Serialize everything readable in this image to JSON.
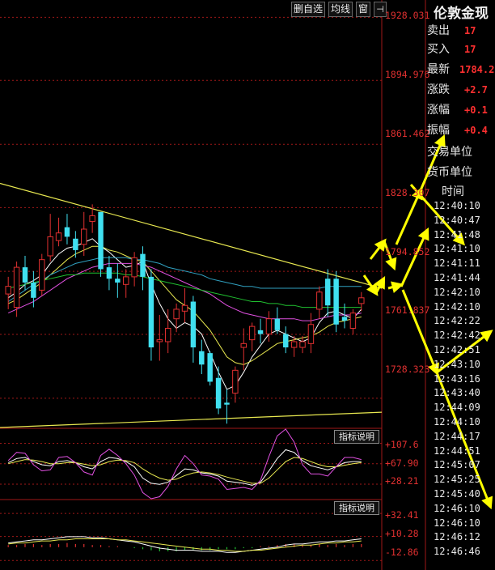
{
  "toolbar": {
    "delete_label": "删自选",
    "ma_label": "均线",
    "window_label": "窗",
    "pin_icon": "pin-icon"
  },
  "price_axis": [
    "1928.031",
    "1894.976",
    "1861.462",
    "1828.307",
    "1794.852",
    "1761.837",
    "1728.323"
  ],
  "indicator1": {
    "button": "指标说明",
    "labels": [
      "+107.6",
      "+67.90",
      "+28.21"
    ]
  },
  "indicator2": {
    "button": "指标说明",
    "labels": [
      "+32.41",
      "+10.28",
      "-12.86"
    ]
  },
  "quote_panel": {
    "title": "伦敦金现",
    "rows": [
      {
        "label": "卖出",
        "value": "17"
      },
      {
        "label": "买入",
        "value": "17"
      },
      {
        "label": "最新",
        "value": "1784.2"
      },
      {
        "label": "涨跌",
        "value": "+2.7"
      },
      {
        "label": "涨幅",
        "value": "+0.1"
      },
      {
        "label": "振幅",
        "value": "+0.4"
      }
    ],
    "trade_unit": "交易单位",
    "currency_unit": "货币单位",
    "time_header": "时间",
    "times": [
      "12:40:10",
      "12:40:47",
      "12:41:48",
      "12:41:10",
      "12:41:11",
      "12:41:44",
      "12:42:10",
      "12:42:10",
      "12:42:22",
      "12:42:42",
      "12:42:51",
      "12:43:10",
      "12:43:16",
      "12:43:40",
      "12:44:09",
      "12:44:10",
      "12:44:17",
      "12:44:51",
      "12:45:07",
      "12:45:25",
      "12:45:40",
      "12:46:10",
      "12:46:10",
      "12:46:12",
      "12:46:46"
    ]
  },
  "colors": {
    "up": "#e03030",
    "down": "#40e0f0",
    "arrow": "#ffff00",
    "trendline": "#e8e850",
    "bg": "#000000"
  },
  "chart_data": {
    "type": "candlestick",
    "y_axis_ticks": [
      1928.031,
      1894.976,
      1861.462,
      1828.307,
      1794.852,
      1761.837,
      1728.323
    ],
    "ylim": [
      1713,
      1935
    ],
    "candles": [
      {
        "o": 1783,
        "h": 1792,
        "l": 1775,
        "c": 1787
      },
      {
        "o": 1776,
        "h": 1800,
        "l": 1771,
        "c": 1797
      },
      {
        "o": 1797,
        "h": 1803,
        "l": 1785,
        "c": 1789
      },
      {
        "o": 1789,
        "h": 1795,
        "l": 1776,
        "c": 1781
      },
      {
        "o": 1785,
        "h": 1804,
        "l": 1782,
        "c": 1801
      },
      {
        "o": 1803,
        "h": 1825,
        "l": 1800,
        "c": 1813
      },
      {
        "o": 1811,
        "h": 1823,
        "l": 1808,
        "c": 1815
      },
      {
        "o": 1818,
        "h": 1825,
        "l": 1809,
        "c": 1813
      },
      {
        "o": 1812,
        "h": 1816,
        "l": 1802,
        "c": 1806
      },
      {
        "o": 1809,
        "h": 1826,
        "l": 1803,
        "c": 1817
      },
      {
        "o": 1821,
        "h": 1830,
        "l": 1815,
        "c": 1824
      },
      {
        "o": 1826,
        "h": 1824,
        "l": 1792,
        "c": 1796
      },
      {
        "o": 1797,
        "h": 1803,
        "l": 1785,
        "c": 1791
      },
      {
        "o": 1791,
        "h": 1799,
        "l": 1781,
        "c": 1789
      },
      {
        "o": 1788,
        "h": 1796,
        "l": 1781,
        "c": 1792
      },
      {
        "o": 1792,
        "h": 1805,
        "l": 1787,
        "c": 1802
      },
      {
        "o": 1804,
        "h": 1808,
        "l": 1785,
        "c": 1792
      },
      {
        "o": 1792,
        "h": 1796,
        "l": 1748,
        "c": 1755
      },
      {
        "o": 1758,
        "h": 1772,
        "l": 1748,
        "c": 1759
      },
      {
        "o": 1758,
        "h": 1775,
        "l": 1752,
        "c": 1765
      },
      {
        "o": 1770,
        "h": 1778,
        "l": 1763,
        "c": 1775
      },
      {
        "o": 1774,
        "h": 1786,
        "l": 1768,
        "c": 1777
      },
      {
        "o": 1779,
        "h": 1782,
        "l": 1747,
        "c": 1755
      },
      {
        "o": 1753,
        "h": 1759,
        "l": 1741,
        "c": 1746
      },
      {
        "o": 1752,
        "h": 1753,
        "l": 1735,
        "c": 1737
      },
      {
        "o": 1739,
        "h": 1745,
        "l": 1720,
        "c": 1723
      },
      {
        "o": 1726,
        "h": 1733,
        "l": 1715,
        "c": 1725
      },
      {
        "o": 1731,
        "h": 1745,
        "l": 1726,
        "c": 1743
      },
      {
        "o": 1755,
        "h": 1765,
        "l": 1743,
        "c": 1757
      },
      {
        "o": 1759,
        "h": 1768,
        "l": 1753,
        "c": 1766
      },
      {
        "o": 1764,
        "h": 1770,
        "l": 1757,
        "c": 1762
      },
      {
        "o": 1762,
        "h": 1774,
        "l": 1758,
        "c": 1770
      },
      {
        "o": 1770,
        "h": 1776,
        "l": 1762,
        "c": 1764
      },
      {
        "o": 1762,
        "h": 1766,
        "l": 1752,
        "c": 1755
      },
      {
        "o": 1755,
        "h": 1761,
        "l": 1750,
        "c": 1758
      },
      {
        "o": 1755,
        "h": 1761,
        "l": 1752,
        "c": 1758
      },
      {
        "o": 1757,
        "h": 1773,
        "l": 1752,
        "c": 1767
      },
      {
        "o": 1775,
        "h": 1787,
        "l": 1770,
        "c": 1784
      },
      {
        "o": 1791,
        "h": 1796,
        "l": 1771,
        "c": 1777
      },
      {
        "o": 1791,
        "h": 1795,
        "l": 1763,
        "c": 1767
      },
      {
        "o": 1771,
        "h": 1778,
        "l": 1765,
        "c": 1769
      },
      {
        "o": 1765,
        "h": 1775,
        "l": 1762,
        "c": 1773
      },
      {
        "o": 1778,
        "h": 1784,
        "l": 1774,
        "c": 1781
      }
    ],
    "moving_averages": [
      {
        "name": "MA1",
        "color": "#ffffff",
        "values": [
          1781,
          1784,
          1788,
          1790,
          1793,
          1799,
          1804,
          1807,
          1808,
          1810,
          1812,
          1808,
          1805,
          1801,
          1797,
          1798,
          1800,
          1788,
          1778,
          1770,
          1765,
          1768,
          1766,
          1762,
          1752,
          1742,
          1733,
          1735,
          1742,
          1750,
          1756,
          1762,
          1764,
          1762,
          1760,
          1758,
          1760,
          1768,
          1773,
          1774,
          1772,
          1770,
          1775
        ]
      },
      {
        "name": "MA2",
        "color": "#e8e850",
        "values": [
          1778,
          1780,
          1783,
          1786,
          1789,
          1793,
          1797,
          1801,
          1804,
          1806,
          1808,
          1808,
          1806,
          1805,
          1803,
          1801,
          1800,
          1795,
          1790,
          1785,
          1780,
          1777,
          1774,
          1769,
          1764,
          1757,
          1750,
          1747,
          1746,
          1748,
          1751,
          1754,
          1757,
          1758,
          1759,
          1760,
          1761,
          1763,
          1766,
          1768,
          1769,
          1770,
          1771
        ]
      },
      {
        "name": "MA3",
        "color": "#e050e0",
        "values": [
          1773,
          1775,
          1777,
          1779,
          1782,
          1785,
          1788,
          1791,
          1793,
          1795,
          1797,
          1798,
          1799,
          1799,
          1799,
          1799,
          1798,
          1797,
          1795,
          1793,
          1791,
          1789,
          1787,
          1785,
          1783,
          1780,
          1777,
          1775,
          1773,
          1772,
          1771,
          1770,
          1770,
          1770,
          1770,
          1769,
          1769,
          1770,
          1771,
          1772,
          1772,
          1772,
          1773
        ]
      },
      {
        "name": "MA4",
        "color": "#20c030",
        "values": [
          1786,
          1787,
          1788,
          1789,
          1790,
          1791,
          1792,
          1793,
          1793,
          1794,
          1794,
          1794,
          1794,
          1794,
          1793,
          1793,
          1792,
          1791,
          1790,
          1789,
          1788,
          1787,
          1786,
          1785,
          1784,
          1783,
          1782,
          1781,
          1780,
          1779,
          1779,
          1778,
          1778,
          1777,
          1777,
          1776,
          1776,
          1776,
          1776,
          1776,
          1776,
          1776,
          1776
        ]
      },
      {
        "name": "MA5",
        "color": "#30a0c0",
        "values": [
          1779,
          1782,
          1785,
          1788,
          1790,
          1793,
          1795,
          1797,
          1799,
          1800,
          1801,
          1802,
          1802,
          1802,
          1802,
          1801,
          1801,
          1800,
          1799,
          1797,
          1796,
          1795,
          1794,
          1793,
          1791,
          1790,
          1789,
          1788,
          1787,
          1787,
          1786,
          1786,
          1786,
          1786,
          1786,
          1786,
          1786,
          1786,
          1787,
          1787,
          1787,
          1787,
          1787
        ]
      }
    ],
    "trendlines": [
      {
        "from": [
          0,
          1841
        ],
        "to": [
          43,
          1786
        ]
      },
      {
        "from": [
          0,
          1713
        ],
        "to": [
          43,
          1721
        ]
      }
    ],
    "indicator1": {
      "ticks": [
        107.6,
        67.9,
        28.21
      ],
      "ylim": [
        0,
        135
      ],
      "series": [
        {
          "name": "K",
          "color": "#ffffff",
          "values": [
            70,
            78,
            80,
            72,
            66,
            64,
            72,
            74,
            70,
            62,
            58,
            72,
            80,
            78,
            72,
            62,
            40,
            30,
            28,
            32,
            45,
            58,
            56,
            50,
            48,
            44,
            34,
            32,
            30,
            26,
            32,
            54,
            78,
            95,
            90,
            74,
            64,
            60,
            56,
            62,
            70,
            72,
            72
          ]
        },
        {
          "name": "D",
          "color": "#e8e850",
          "values": [
            68,
            72,
            76,
            75,
            72,
            68,
            68,
            70,
            70,
            67,
            64,
            66,
            72,
            75,
            74,
            70,
            58,
            48,
            40,
            36,
            38,
            45,
            50,
            52,
            50,
            47,
            42,
            38,
            34,
            30,
            30,
            40,
            56,
            72,
            80,
            78,
            72,
            66,
            62,
            62,
            65,
            68,
            70
          ]
        },
        {
          "name": "J",
          "color": "#e050e0",
          "values": [
            74,
            90,
            88,
            66,
            54,
            56,
            80,
            82,
            70,
            52,
            46,
            84,
            96,
            84,
            68,
            46,
            12,
            -6,
            4,
            24,
            58,
            84,
            68,
            46,
            44,
            38,
            18,
            20,
            22,
            18,
            36,
            82,
            122,
            141,
            110,
            66,
            48,
            48,
            44,
            62,
            80,
            80,
            76
          ]
        }
      ]
    },
    "indicator2": {
      "ticks": [
        32.41,
        10.28,
        -12.86
      ],
      "ylim": [
        -22,
        45
      ],
      "series": [
        {
          "name": "DIF",
          "color": "#ffffff",
          "values": [
            4,
            5,
            6,
            7,
            7,
            8,
            9,
            10,
            10,
            10,
            9,
            9,
            8,
            7,
            6,
            5,
            3,
            1,
            -1,
            -2,
            -3,
            -3,
            -3,
            -4,
            -4,
            -4,
            -5,
            -5,
            -4,
            -3,
            -2,
            -1,
            0,
            2,
            3,
            3,
            4,
            5,
            5,
            6,
            6,
            7,
            8
          ]
        },
        {
          "name": "DEA",
          "color": "#e8e850",
          "values": [
            3,
            4,
            4,
            5,
            6,
            6,
            7,
            7,
            8,
            8,
            8,
            8,
            8,
            7,
            7,
            6,
            5,
            4,
            3,
            2,
            1,
            0,
            -1,
            -2,
            -2,
            -3,
            -3,
            -4,
            -4,
            -3,
            -3,
            -2,
            -1,
            0,
            1,
            2,
            2,
            3,
            4,
            4,
            5,
            5,
            6
          ]
        }
      ],
      "histogram": [
        2,
        2,
        3,
        3,
        2,
        3,
        3,
        4,
        3,
        3,
        2,
        2,
        1,
        1,
        0,
        -1,
        -2,
        -3,
        -4,
        -4,
        -4,
        -3,
        -3,
        -3,
        -3,
        -2,
        -2,
        -2,
        -1,
        -1,
        1,
        1,
        2,
        3,
        3,
        2,
        2,
        3,
        2,
        3,
        2,
        3,
        3
      ]
    },
    "annotation_arrows": [
      {
        "from": [
          458,
          320
        ],
        "to": [
          475,
          298
        ]
      },
      {
        "from": [
          475,
          298
        ],
        "to": [
          487,
          330
        ]
      },
      {
        "from": [
          450,
          340
        ],
        "to": [
          465,
          362
        ]
      },
      {
        "from": [
          465,
          362
        ],
        "to": [
          474,
          345
        ]
      },
      {
        "from": [
          480,
          356
        ],
        "to": [
          495,
          352
        ]
      },
      {
        "from": [
          490,
          302
        ],
        "to": [
          520,
          235
        ]
      },
      {
        "from": [
          520,
          235
        ],
        "to": [
          548,
          170
        ]
      },
      {
        "from": [
          508,
          228
        ],
        "to": [
          572,
          300
        ]
      },
      {
        "from": [
          496,
          354
        ],
        "to": [
          528,
          285
        ]
      },
      {
        "from": [
          498,
          358
        ],
        "to": [
          540,
          460
        ]
      },
      {
        "from": [
          540,
          460
        ],
        "to": [
          606,
          410
        ]
      },
      {
        "from": [
          540,
          460
        ],
        "to": [
          606,
          625
        ]
      }
    ]
  }
}
